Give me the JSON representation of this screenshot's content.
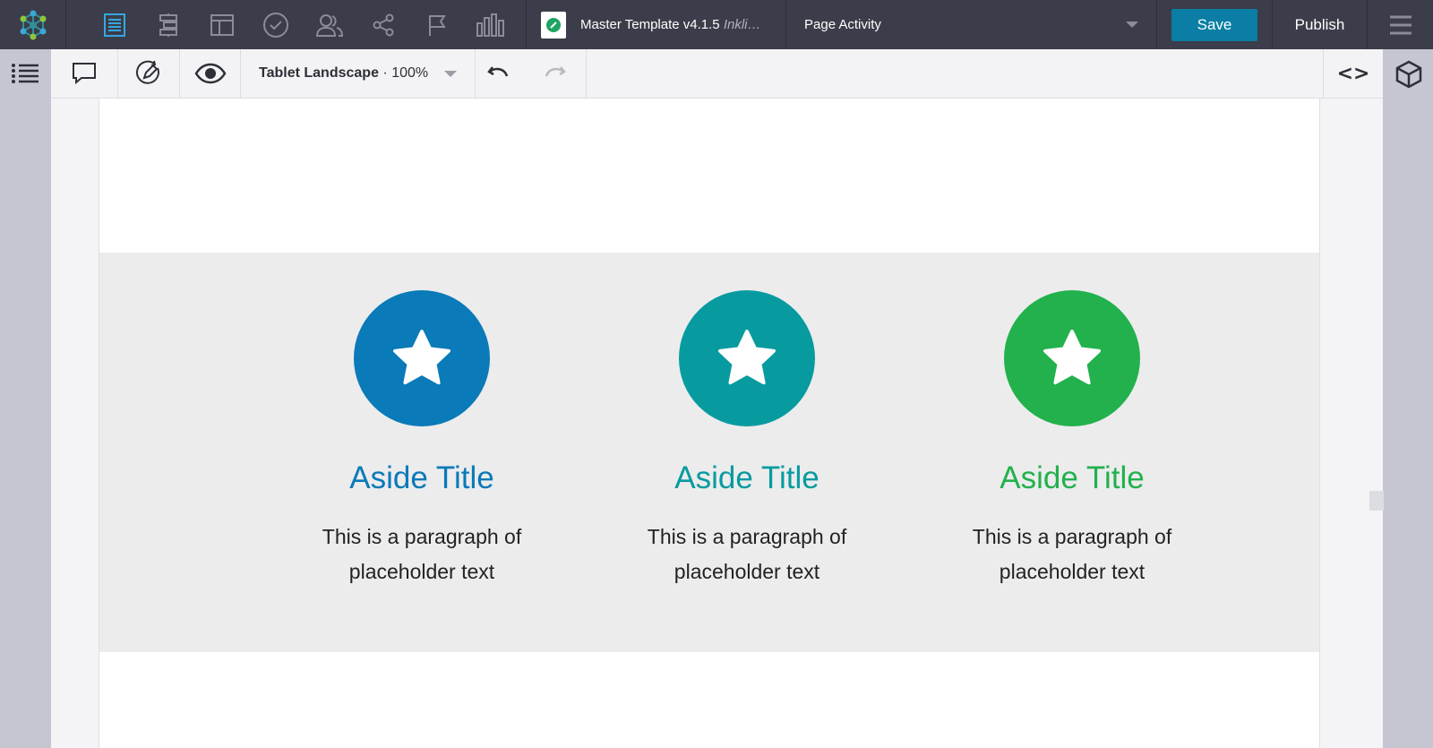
{
  "topbar": {
    "doc_title": "Master Template v4.1.5",
    "doc_subtitle": "Inkli…",
    "page_selector": "Page Activity",
    "save_label": "Save",
    "publish_label": "Publish"
  },
  "subbar": {
    "viewport_label": "Tablet Landscape",
    "zoom_label": "· 100%",
    "code_label": "<>"
  },
  "asides": [
    {
      "title": "Aside Title",
      "line1": "This is a paragraph of",
      "line2": "placeholder text",
      "color": "#0a7ab8"
    },
    {
      "title": "Aside Title",
      "line1": "This is a paragraph of",
      "line2": "placeholder text",
      "color": "#079ba0"
    },
    {
      "title": "Aside Title",
      "line1": "This is a paragraph of",
      "line2": "placeholder text",
      "color": "#22b14c"
    }
  ],
  "colors": {
    "topbar_bg": "#3b3d4a",
    "accent": "#35a7e0",
    "save_button": "#0a7ea4",
    "aside_band": "#ececed"
  }
}
